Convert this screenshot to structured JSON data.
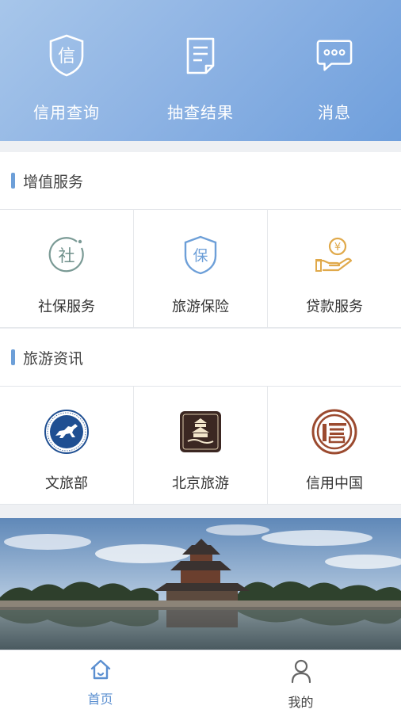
{
  "top_actions": [
    {
      "label": "信用查询",
      "icon": "shield-xin-icon"
    },
    {
      "label": "抽查结果",
      "icon": "document-icon"
    },
    {
      "label": "消息",
      "icon": "chat-bubble-icon"
    }
  ],
  "sections": {
    "value_added": {
      "title": "增值服务",
      "items": [
        {
          "label": "社保服务",
          "icon": "social-security-icon",
          "glyph": "社"
        },
        {
          "label": "旅游保险",
          "icon": "insurance-shield-icon",
          "glyph": "保"
        },
        {
          "label": "贷款服务",
          "icon": "loan-coin-hand-icon",
          "glyph": "¥"
        }
      ]
    },
    "travel_news": {
      "title": "旅游资讯",
      "items": [
        {
          "label": "文旅部",
          "icon": "ministry-culture-tourism-logo"
        },
        {
          "label": "北京旅游",
          "icon": "beijing-tourism-logo"
        },
        {
          "label": "信用中国",
          "icon": "credit-china-logo"
        }
      ]
    }
  },
  "tabbar": {
    "home": {
      "label": "首页",
      "active": true
    },
    "mine": {
      "label": "我的",
      "active": false
    }
  },
  "colors": {
    "accent": "#6d9fd8",
    "tab_active": "#5b8fd0",
    "loan_gold": "#e0a94a",
    "credit_china_brown": "#9b4a2f"
  }
}
